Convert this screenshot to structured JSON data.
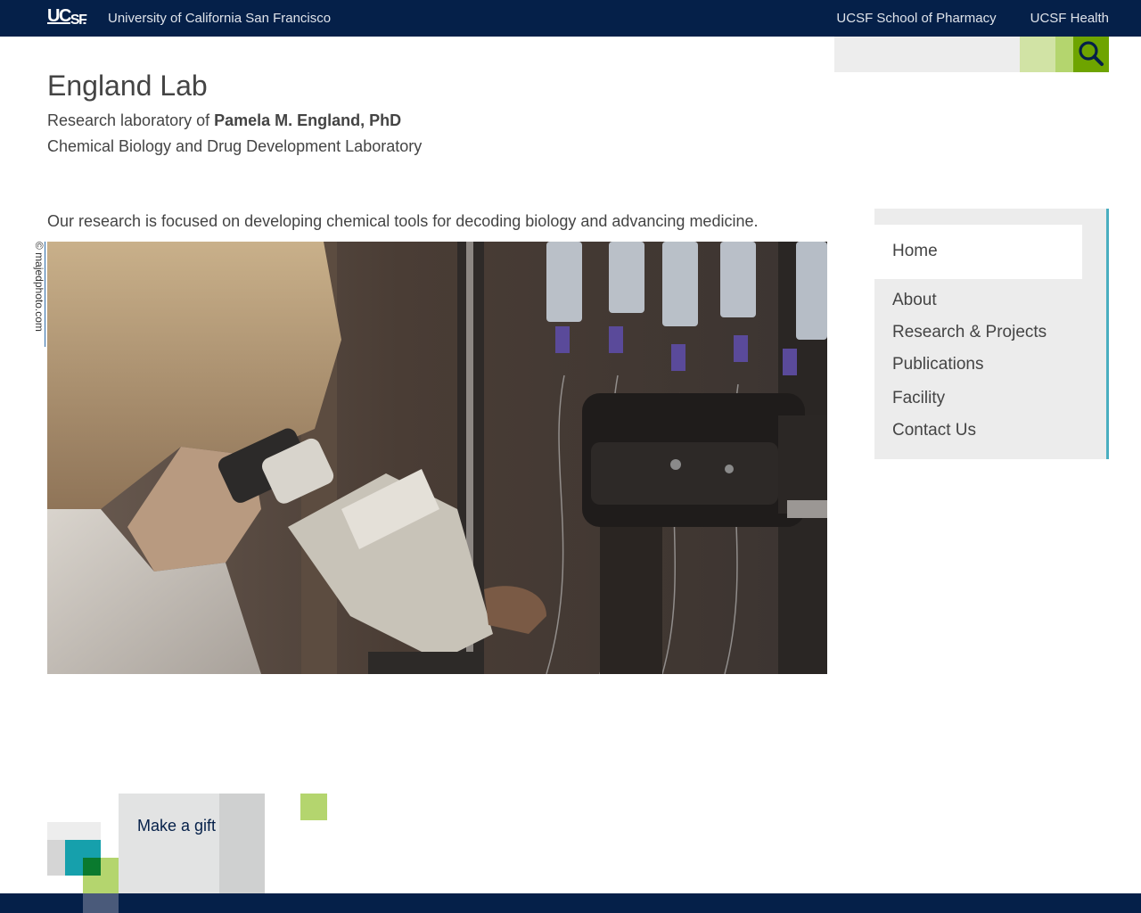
{
  "header": {
    "logo_text": "UCSF",
    "university_name": "University of California San Francisco",
    "links": [
      "UCSF School of Pharmacy",
      "UCSF Health"
    ]
  },
  "search": {
    "placeholder": "",
    "icon": "search-icon"
  },
  "site": {
    "title": "England Lab",
    "tagline_prefix": "Research laboratory of ",
    "tagline_name": "Pamela M. England, PhD",
    "tagline2": "Chemical Biology and Drug Development Laboratory"
  },
  "main": {
    "intro": "Our research is focused on developing chemical tools for decoding biology and advancing medicine.",
    "photo_credit": "© majedphoto.com"
  },
  "nav": {
    "items": [
      "Home",
      "About",
      "Research & Projects",
      "Publications",
      "Facility",
      "Contact Us"
    ],
    "active": "Home"
  },
  "footer": {
    "gift_link": "Make a gift"
  },
  "colors": {
    "navy": "#052049",
    "green": "#6ea400",
    "light_green": "#b4d56e",
    "teal": "#16a0ac",
    "nav_border": "#4aaec0"
  }
}
